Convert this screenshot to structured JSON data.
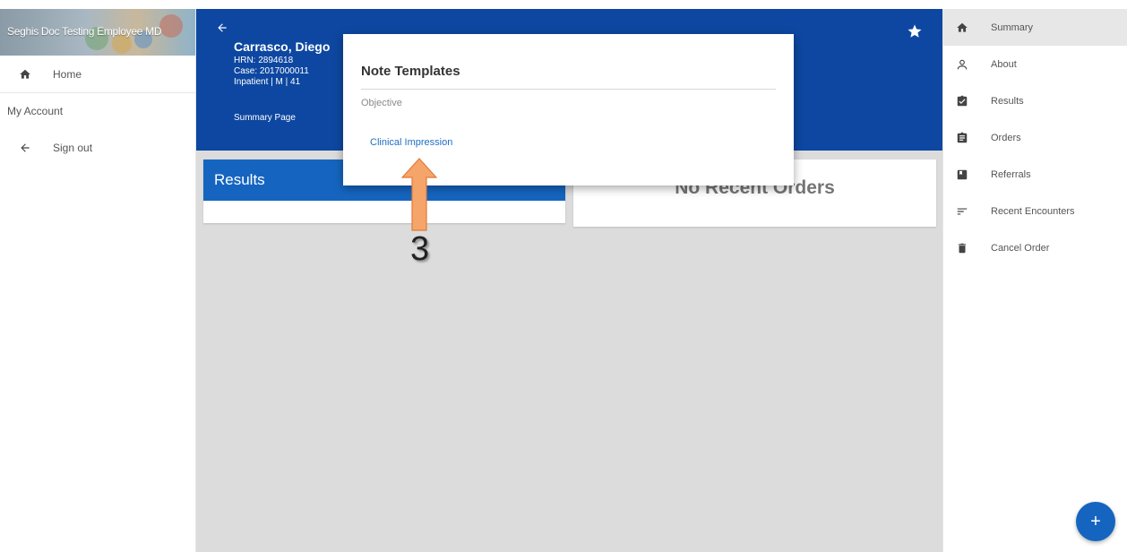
{
  "left_nav": {
    "user_name": "Seghis Doc Testing Employee MD",
    "items": [
      {
        "label": "Home",
        "icon": "home-icon"
      },
      {
        "label": "My Account"
      },
      {
        "label": "Sign out",
        "icon": "arrow-left-icon"
      }
    ]
  },
  "patient": {
    "name": "Carrasco, Diego",
    "hrn": "HRN: 2894618",
    "case": "Case: 2017000011",
    "status": "Inpatient | M | 41",
    "page": "Summary Page"
  },
  "cards": {
    "results_title": "Results",
    "orders_empty": "No Recent Orders"
  },
  "modal": {
    "title": "Note Templates",
    "section": "Objective",
    "link": "Clinical Impression"
  },
  "annotation": {
    "number": "3",
    "color": "#f4a460"
  },
  "right_nav": {
    "items": [
      {
        "label": "Summary",
        "icon": "home-icon"
      },
      {
        "label": "About",
        "icon": "person-icon"
      },
      {
        "label": "Results",
        "icon": "clipboard-check-icon"
      },
      {
        "label": "Orders",
        "icon": "clipboard-list-icon"
      },
      {
        "label": "Referrals",
        "icon": "bookmark-box-icon"
      },
      {
        "label": "Recent Encounters",
        "icon": "sort-lines-icon"
      },
      {
        "label": "Cancel Order",
        "icon": "trash-icon"
      }
    ],
    "fab_label": "+"
  },
  "colors": {
    "header_blue": "#0d47a1",
    "card_blue": "#1565c0",
    "link_blue": "#1e6fc2",
    "background_gray": "#dcdcdc"
  }
}
